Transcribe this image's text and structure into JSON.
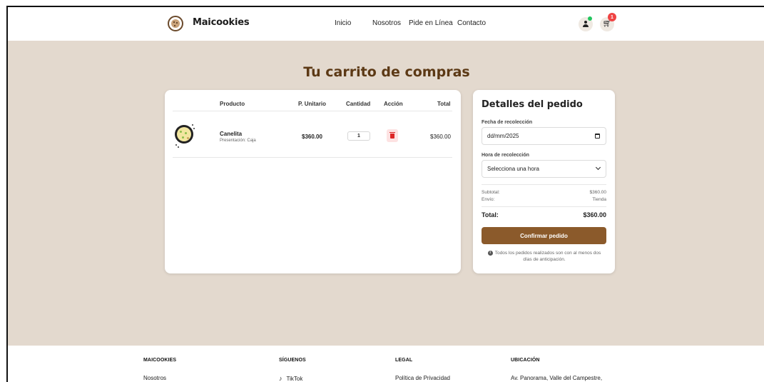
{
  "header": {
    "brand": "Maicookies",
    "nav": [
      "Inicio",
      "Nosotros",
      "Pide en Línea",
      "Contacto"
    ],
    "cart_badge": "1"
  },
  "page_title": "Tu carrito de compras",
  "cart": {
    "columns": [
      "Producto",
      "P. Unitario",
      "Cantidad",
      "Acción",
      "Total"
    ],
    "items": [
      {
        "name": "Canelita",
        "presentation": "Presentación: Caja",
        "unit_price": "$360.00",
        "quantity": "1",
        "total": "$360.00"
      }
    ]
  },
  "order": {
    "title": "Detalles del pedido",
    "date_label": "Fecha de recolección",
    "date_value": "dd/mm/2025",
    "time_label": "Hora de recolección",
    "time_value": "Selecciona una hora",
    "subtotal_label": "Subtotal:",
    "subtotal_value": "$360.00",
    "shipping_label": "Envío:",
    "shipping_value": "Tienda",
    "total_label": "Total:",
    "total_value": "$360.00",
    "confirm_label": "Confirmar pedido",
    "note": "Todos los pedidos realizados son con al menos dos días de anticipación."
  },
  "footer": {
    "columns": [
      {
        "heading": "MAICOOKIES",
        "first_link": "Nosotros"
      },
      {
        "heading": "SÍGUENOS",
        "first_link": "TikTok"
      },
      {
        "heading": "LEGAL",
        "first_link": "Política de Privacidad"
      },
      {
        "heading": "UBICACIÓN",
        "first_link": "Av. Panorama, Valle del Campestre,"
      }
    ]
  },
  "colors": {
    "accent": "#8b5a2b",
    "title": "#5c3915",
    "background": "#e3d9ce",
    "badge": "#ef4444"
  }
}
